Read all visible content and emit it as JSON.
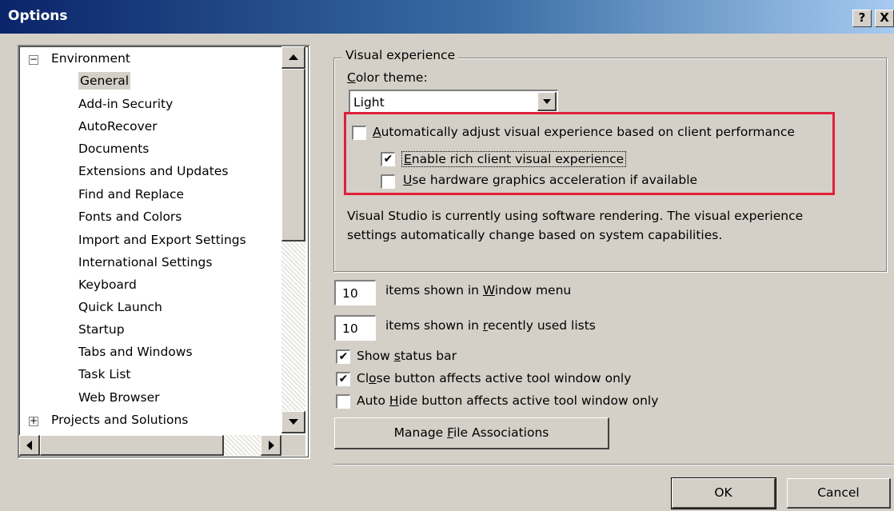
{
  "window": {
    "title": "Options",
    "help_btn": "?",
    "close_btn": "X"
  },
  "tree": {
    "environment": "Environment",
    "env_expander": "−",
    "children": [
      "General",
      "Add-in Security",
      "AutoRecover",
      "Documents",
      "Extensions and Updates",
      "Find and Replace",
      "Fonts and Colors",
      "Import and Export Settings",
      "International Settings",
      "Keyboard",
      "Quick Launch",
      "Startup",
      "Tabs and Windows",
      "Task List",
      "Web Browser"
    ],
    "selected": "General",
    "projects": "Projects and Solutions",
    "proj_expander": "+"
  },
  "visual": {
    "group_title": "Visual experience",
    "color_theme_label_pre": "",
    "color_theme_label_u": "C",
    "color_theme_label_post": "olor theme:",
    "color_theme_value": "Light",
    "auto_adjust": {
      "u": "A",
      "rest": "utomatically adjust visual experience based on client performance",
      "checked": false
    },
    "rich_client": {
      "u": "E",
      "rest": "nable rich client visual experience",
      "checked": true,
      "check": "✔"
    },
    "hw_accel": {
      "u": "U",
      "rest": "se hardware graphics acceleration if available",
      "checked": false
    },
    "info_line1": "Visual Studio is currently using software rendering.  The visual experience",
    "info_line2": "settings automatically change based on system capabilities."
  },
  "window_menu": {
    "value": "10",
    "pre": "items shown in ",
    "u": "W",
    "post": "indow menu"
  },
  "recent_lists": {
    "value": "10",
    "pre": "items shown in ",
    "u": "r",
    "post": "ecently used lists"
  },
  "options": {
    "status_bar": {
      "pre": "Show ",
      "u": "s",
      "post": "tatus bar",
      "checked": true,
      "check": "✔"
    },
    "close_button": {
      "pre": "Cl",
      "u": "o",
      "post": "se button affects active tool window only",
      "checked": true,
      "check": "✔"
    },
    "auto_hide": {
      "pre": "Auto ",
      "u": "H",
      "post": "ide button affects active tool window only",
      "checked": false
    }
  },
  "manage_btn": {
    "pre": "Manage ",
    "u": "F",
    "post": "ile Associations"
  },
  "footer": {
    "ok": "OK",
    "cancel": "Cancel"
  }
}
